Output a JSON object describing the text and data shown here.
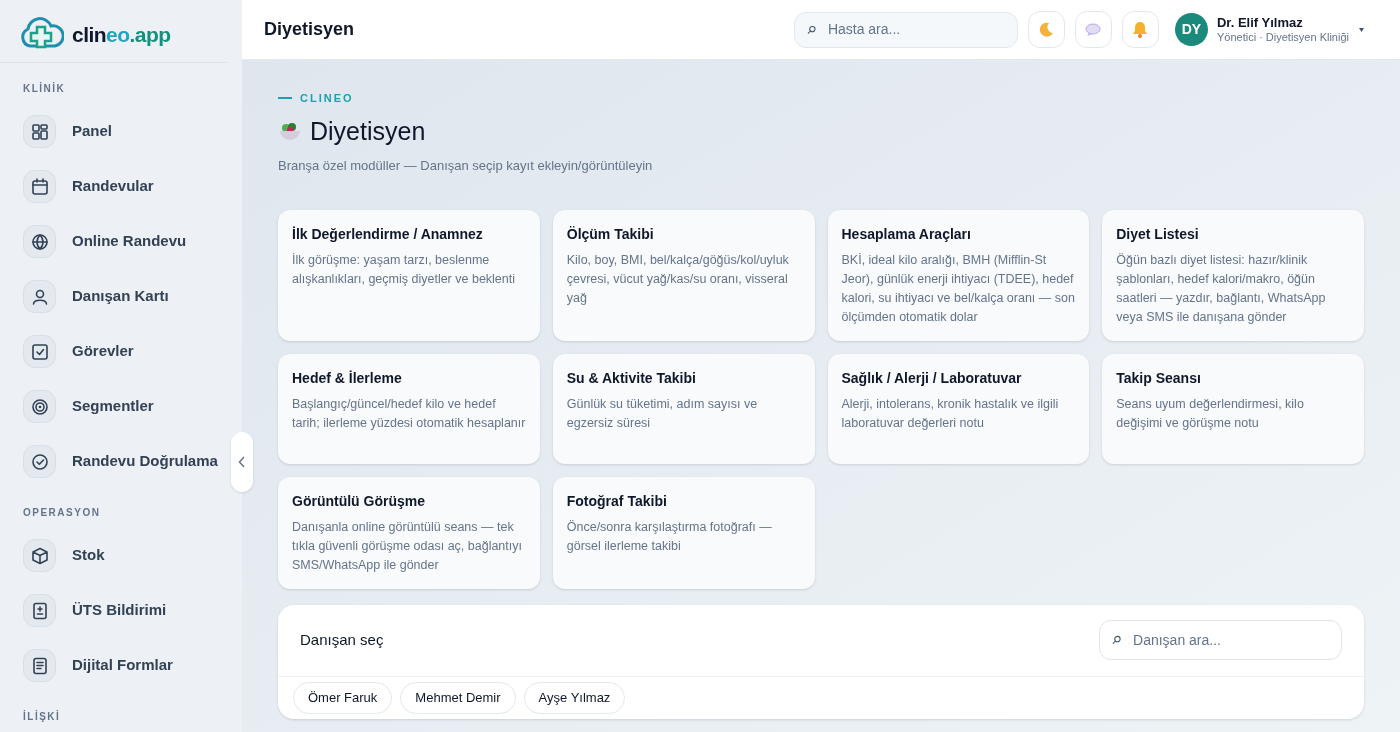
{
  "brand": {
    "name_dark": "clin",
    "name_accent": "eo",
    "name_suffix": ".app"
  },
  "sidebar": {
    "sections": [
      {
        "title": "KLİNİK",
        "items": [
          {
            "label": "Panel"
          },
          {
            "label": "Randevular"
          },
          {
            "label": "Online Randevu"
          },
          {
            "label": "Danışan Kartı"
          },
          {
            "label": "Görevler"
          },
          {
            "label": "Segmentler"
          },
          {
            "label": "Randevu Doğrulama"
          }
        ]
      },
      {
        "title": "OPERASYON",
        "items": [
          {
            "label": "Stok"
          },
          {
            "label": "ÜTS Bildirimi"
          },
          {
            "label": "Dijital Formlar"
          }
        ]
      },
      {
        "title": "İLİŞKİ"
      }
    ]
  },
  "header": {
    "title": "Diyetisyen",
    "search_placeholder": "Hasta ara...",
    "user": {
      "initials": "DY",
      "name": "Dr. Elif Yılmaz",
      "role": "Yönetici · Diyetisyen Kliniği"
    }
  },
  "page": {
    "eyebrow": "CLINEO",
    "title": "Diyetisyen",
    "subtitle": "Branşa özel modüller — Danışan seçip kayıt ekleyin/görüntüleyin"
  },
  "modules": [
    {
      "title": "İlk Değerlendirme / Anamnez",
      "description": "İlk görüşme: yaşam tarzı, beslenme alışkanlıkları, geçmiş diyetler ve beklenti"
    },
    {
      "title": "Ölçüm Takibi",
      "description": "Kilo, boy, BMI, bel/kalça/göğüs/kol/uyluk çevresi, vücut yağ/kas/su oranı, visseral yağ"
    },
    {
      "title": "Hesaplama Araçları",
      "description": "BKİ, ideal kilo aralığı, BMH (Mifflin-St Jeor), günlük enerji ihtiyacı (TDEE), hedef kalori, su ihtiyacı ve bel/kalça oranı — son ölçümden otomatik dolar"
    },
    {
      "title": "Diyet Listesi",
      "description": "Öğün bazlı diyet listesi: hazır/klinik şablonları, hedef kalori/makro, öğün saatleri — yazdır, bağlantı, WhatsApp veya SMS ile danışana gönder"
    },
    {
      "title": "Hedef & İlerleme",
      "description": "Başlangıç/güncel/hedef kilo ve hedef tarih; ilerleme yüzdesi otomatik hesaplanır"
    },
    {
      "title": "Su & Aktivite Takibi",
      "description": "Günlük su tüketimi, adım sayısı ve egzersiz süresi"
    },
    {
      "title": "Sağlık / Alerji / Laboratuvar",
      "description": "Alerji, intolerans, kronik hastalık ve ilgili laboratuvar değerleri notu"
    },
    {
      "title": "Takip Seansı",
      "description": "Seans uyum değerlendirmesi, kilo değişimi ve görüşme notu"
    },
    {
      "title": "Görüntülü Görüşme",
      "description": "Danışanla online görüntülü seans — tek tıkla güvenli görüşme odası aç, bağlantıyı SMS/WhatsApp ile gönder"
    },
    {
      "title": "Fotoğraf Takibi",
      "description": "Önce/sonra karşılaştırma fotoğrafı — görsel ilerleme takibi"
    }
  ],
  "client_picker": {
    "title": "Danışan seç",
    "search_placeholder": "Danışan ara...",
    "clients": [
      {
        "name": "Ömer Faruk"
      },
      {
        "name": "Mehmet Demir"
      },
      {
        "name": "Ayşe Yılmaz"
      }
    ]
  }
}
